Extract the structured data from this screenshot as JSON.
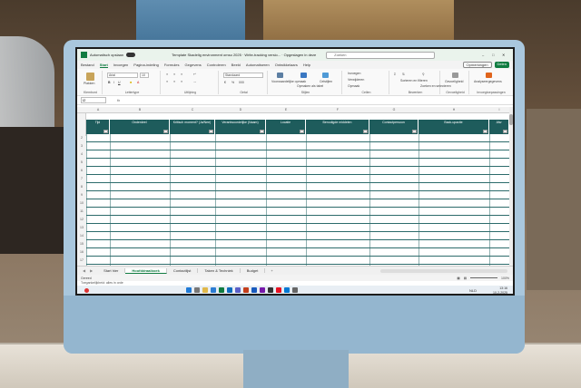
{
  "titlebar": {
    "autosave": "Automatisch opslaan",
    "title": "Template Skadelig environment omso 2025 · Write-tracking versio... · Opgeslagen in deze pc",
    "search_placeholder": "Zoeken"
  },
  "menu": {
    "items": [
      "Bestand",
      "Start",
      "Invoegen",
      "Pagina-indeling",
      "Formules",
      "Gegevens",
      "Controleren",
      "Beeld",
      "Automatiseren",
      "Ontwikkelaars",
      "Help"
    ],
    "comments": "Opmerkingen",
    "share": "Delen"
  },
  "ribbon": {
    "paste": "Plakken",
    "font_name": "Arial",
    "font_size": "10",
    "number_format": "Standaard",
    "conditional": "Voorwaardelijke opmaak",
    "format_table": "Opmaken als tabel",
    "cell_styles": "Celstijlen",
    "insert": "Invoegen",
    "delete": "Verwijderen",
    "format": "Opmaak",
    "sort_filter": "Sorteren en filteren",
    "find_select": "Zoeken en selecteren",
    "sensitivity": "Gevoeligheid",
    "analyze": "Analyseergegevens",
    "groups": [
      "Klembord",
      "Lettertype",
      "Uitlijning",
      "Getal",
      "Stijlen",
      "Cellen",
      "Bewerken",
      "Gevoeligheid",
      "Invoegtoepassingen"
    ]
  },
  "formula": {
    "namebox": "I2",
    "fx": "fx"
  },
  "sheet": {
    "col_letters": [
      "A",
      "B",
      "C",
      "D",
      "E",
      "F",
      "G",
      "H",
      "I"
    ],
    "headers": [
      "Tijd",
      "Onderdeel",
      "Kritisch moment? (Ja/Nee)",
      "Verantwoordelijke (Naam)",
      "Locatie",
      "Benodigde middelen",
      "Contactpersoon",
      "Back-upactie",
      "Afw"
    ],
    "row_numbers": [
      "2",
      "3",
      "4",
      "5",
      "6",
      "7",
      "8",
      "9",
      "10",
      "11",
      "12",
      "13",
      "14",
      "15",
      "16",
      "17"
    ]
  },
  "tabs": {
    "items": [
      "Start hier",
      "Hoofddraaiboek",
      "Contactlijst",
      "Taken & Techniek",
      "Budget"
    ],
    "active": "Hoofddraaiboek",
    "add": "+"
  },
  "status": {
    "left": "Gereed",
    "zoom": "100%"
  },
  "accessibility": "Toegankelijkheid: alles in orde",
  "taskbar": {
    "lang": "NLD",
    "time": "13:16",
    "date": "10-2-2025"
  }
}
